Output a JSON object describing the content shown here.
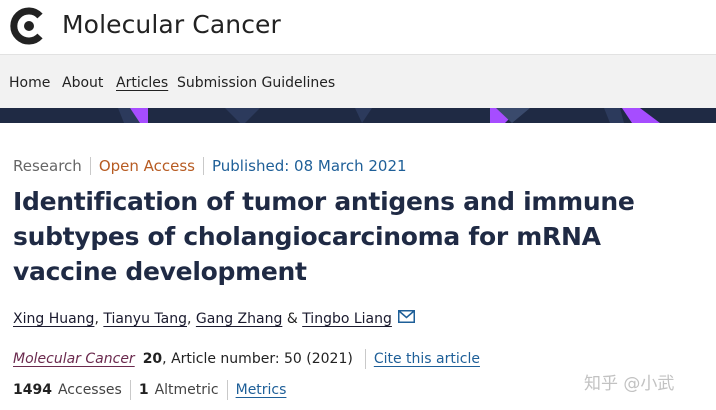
{
  "brand": {
    "name": "Molecular Cancer",
    "logo_icon": "molecular-cancer-logo-icon"
  },
  "nav": {
    "items": [
      {
        "label": "Home"
      },
      {
        "label": "About"
      },
      {
        "label": "Articles",
        "active": true
      },
      {
        "label": "Submission Guidelines"
      }
    ]
  },
  "colors": {
    "banner": "#1f2a44",
    "banner_accent": "#a64dff",
    "title": "#1f2a44",
    "open_access": "#b75c23",
    "link": "#1e5f98",
    "journal_link": "#6b2a4e"
  },
  "article": {
    "type": "Research",
    "access": "Open Access",
    "published": "Published: 08 March 2021",
    "title": "Identification of tumor antigens and immune subtypes of cholangiocarcinoma for mRNA vaccine development",
    "authors": [
      "Xing Huang",
      "Tianyu Tang",
      "Gang Zhang",
      "Tingbo Liang"
    ],
    "author_separators": [
      ",",
      ",",
      "&"
    ],
    "mail_icon": "mail-icon"
  },
  "citation": {
    "journal": "Molecular Cancer",
    "volume": "20",
    "detail": ", Article number: 50 (2021)",
    "cite_link": "Cite this article"
  },
  "metrics": {
    "accesses_count": "1494",
    "accesses_label": "Accesses",
    "altmetric_count": "1",
    "altmetric_label": "Altmetric",
    "metrics_link": "Metrics"
  },
  "watermark": "知乎 @小武"
}
